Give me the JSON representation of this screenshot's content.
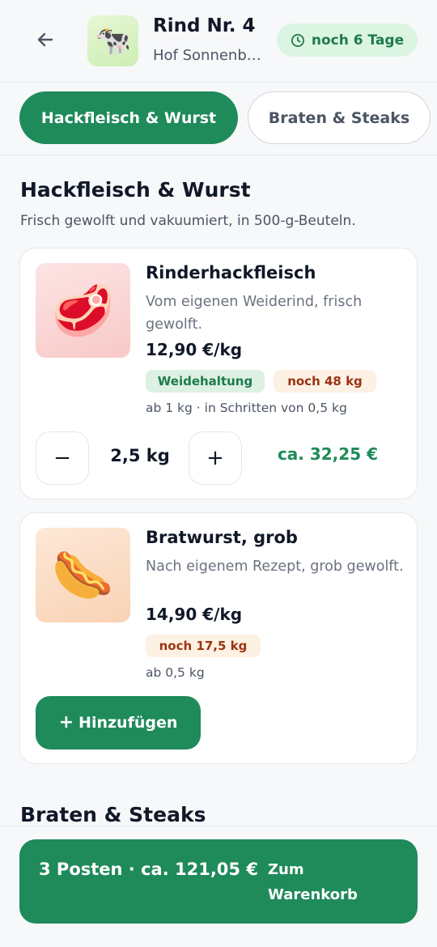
{
  "header": {
    "back_icon": "arrow-left-icon",
    "animal_emoji": "🐄",
    "title": "Rind Nr. 4",
    "farm": "Hof Sonnenberg",
    "deadline": "noch 6 Tage",
    "deadline_icon": "clock-icon"
  },
  "tabs": [
    {
      "label": "Hackfleisch & Wurst",
      "active": true
    },
    {
      "label": "Braten & Steaks",
      "active": false
    }
  ],
  "sections": [
    {
      "title": "Hackfleisch & Wurst",
      "description": "Frisch gewolft und vakuumiert, in 500-g-Beuteln."
    },
    {
      "title": "Braten & Steaks"
    }
  ],
  "products": [
    {
      "emoji": "🥩",
      "name": "Rinderhackfleisch",
      "description": "Vom eigenen Weiderind, frisch gewolft.",
      "price": "12,90 €/kg",
      "tag": "Weidehaltung",
      "stock": "noch 48 kg",
      "rule": "ab 1 kg · in Schritten von 0,5 kg",
      "quantity": "2,5 kg",
      "line_total": "ca. 32,25 €",
      "decrement_label": "−",
      "increment_label": "+"
    },
    {
      "emoji": "🌭",
      "name": "Bratwurst, grob",
      "description": "Nach eigenem Rezept, grob gewolft.",
      "price": "14,90 €/kg",
      "stock": "noch 17,5 kg",
      "rule": "ab 0,5 kg",
      "add_label": "Hinzufügen",
      "add_prefix": "+"
    }
  ],
  "cart": {
    "summary": "3 Posten · ca. 121,05 €",
    "action": "Zum Warenkorb"
  },
  "colors": {
    "primary": "#1f8a5a",
    "tag_bg": "#dcf1e4",
    "stock_bg": "#fdf1e4",
    "stock_text": "#9a3412",
    "deadline_bg": "#dcf5e3"
  }
}
